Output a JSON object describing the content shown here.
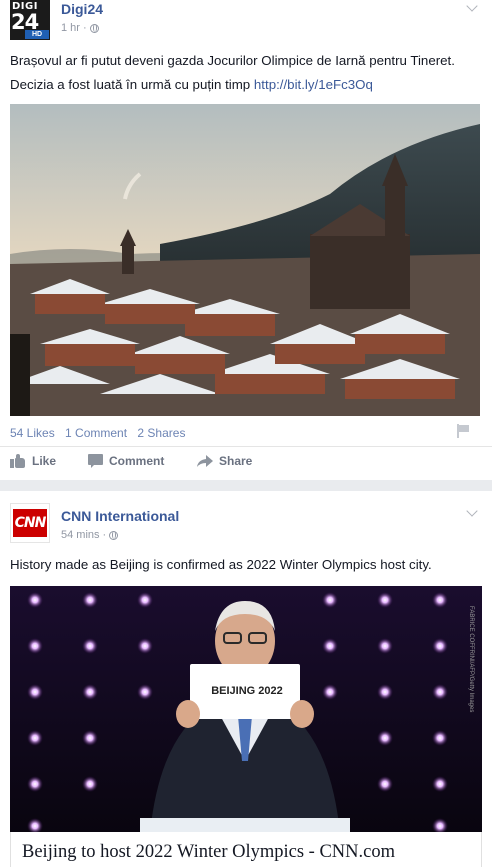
{
  "posts": [
    {
      "page_name": "Digi24",
      "avatar": {
        "top": "DIGI",
        "main": "24",
        "badge": "HD"
      },
      "timestamp": "1 hr",
      "separator": "·",
      "text_line1": "Brașovul ar fi putut deveni gazda Jocurilor Olimpice de Iarnă pentru Tineret.",
      "text_line2": "Decizia a fost luată în urmă cu puțin timp",
      "link": "http://bit.ly/1eFc3Oq",
      "photo_icon": "snowy-town-photo",
      "stats": {
        "likes": "54 Likes",
        "comments": "1 Comment",
        "shares": "2 Shares"
      },
      "actions": {
        "like": "Like",
        "comment": "Comment",
        "share": "Share"
      }
    },
    {
      "page_name": "CNN International",
      "avatar": {
        "logo": "CNN"
      },
      "timestamp": "54 mins",
      "separator": "·",
      "text": "History made as Beijing is confirmed as 2022 Winter Olympics host city.",
      "photo_icon": "announcement-photo",
      "photo_card_text": "BEIJING 2022",
      "photo_credit": "FABRICE COFFRINI/AFP/Getty Images",
      "card_headline": "Beijing to host 2022 Winter Olympics - CNN.com"
    }
  ],
  "colors": {
    "link_blue": "#3b5998",
    "meta_gray": "#9197a3",
    "cnn_red": "#cc0000",
    "feed_bg": "#e9ebee"
  }
}
